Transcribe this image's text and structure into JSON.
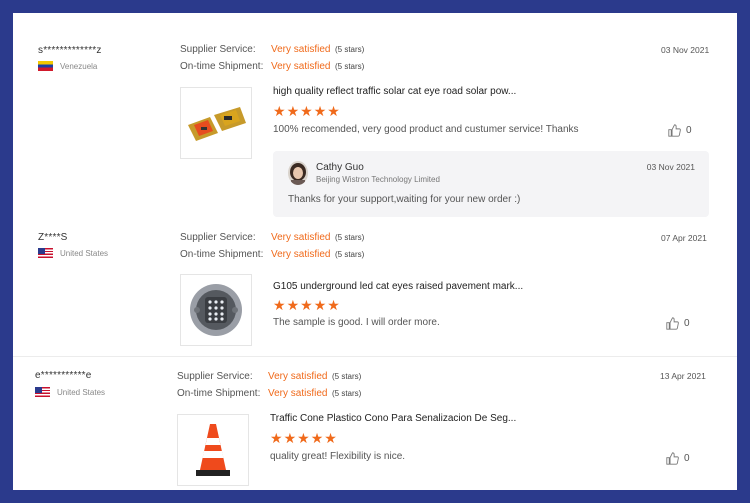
{
  "reviews": [
    {
      "buyer": "s*************z",
      "country": "Venezuela",
      "supplier_service_label": "Supplier Service:",
      "supplier_service_value": "Very satisfied",
      "supplier_service_stars": "(5 stars)",
      "shipment_label": "On-time Shipment:",
      "shipment_value": "Very satisfied",
      "shipment_stars": "(5 stars)",
      "date": "03 Nov 2021",
      "product_title": "high quality reflect traffic solar cat eye road solar pow...",
      "rating": 5,
      "comment": "100% recomended, very good product and custumer service! Thanks",
      "likes": "0",
      "reply": {
        "name": "Cathy Guo",
        "company": "Beijing Wistron Technology Limited",
        "date": "03 Nov 2021",
        "text": "Thanks for your support,waiting for your new order :)"
      }
    },
    {
      "buyer": "Z****S",
      "country": "United States",
      "supplier_service_label": "Supplier Service:",
      "supplier_service_value": "Very satisfied",
      "supplier_service_stars": "(5 stars)",
      "shipment_label": "On-time Shipment:",
      "shipment_value": "Very satisfied",
      "shipment_stars": "(5 stars)",
      "date": "07 Apr 2021",
      "product_title": "G105 underground led cat eyes raised pavement mark...",
      "rating": 5,
      "comment": "The sample is good. I will order more.",
      "likes": "0"
    },
    {
      "buyer": "e***********e",
      "country": "United States",
      "supplier_service_label": "Supplier Service:",
      "supplier_service_value": "Very satisfied",
      "supplier_service_stars": "(5 stars)",
      "shipment_label": "On-time Shipment:",
      "shipment_value": "Very satisfied",
      "shipment_stars": "(5 stars)",
      "date": "13 Apr 2021",
      "product_title": "Traffic Cone Plastico Cono Para Senalizacion De Seg...",
      "rating": 5,
      "comment": "quality great! Flexibility is nice.",
      "likes": "0"
    }
  ],
  "colors": {
    "accent": "#f06a1b",
    "frame": "#2b3a8c"
  },
  "icons": {
    "like": "thumbs-up-icon",
    "star": "star-icon"
  }
}
